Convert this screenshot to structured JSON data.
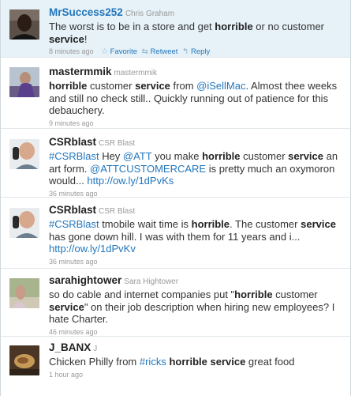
{
  "tweets": [
    {
      "handle": "MrSuccess252",
      "name": "Chris Graham",
      "text": [
        {
          "t": "The worst is to be in a store and get "
        },
        {
          "t": "horrible",
          "b": true
        },
        {
          "t": " or no customer "
        },
        {
          "t": "service",
          "b": true
        },
        {
          "t": "!"
        }
      ],
      "time": "8 minutes ago",
      "actions": [
        {
          "icon": "star-icon",
          "glyph": "☆",
          "label": "Favorite"
        },
        {
          "icon": "retweet-icon",
          "glyph": "⇆",
          "label": "Retweet"
        },
        {
          "icon": "reply-icon",
          "glyph": "↰",
          "label": "Reply"
        }
      ],
      "highlighted": true
    },
    {
      "handle": "mastermmik",
      "name": "mastermmik",
      "text": [
        {
          "t": "horrible",
          "b": true
        },
        {
          "t": " customer "
        },
        {
          "t": "service",
          "b": true
        },
        {
          "t": " from "
        },
        {
          "t": "@iSellMac",
          "l": true
        },
        {
          "t": ". Almost thee weeks and still no check still.. Quickly running out of patience for this debauchery."
        }
      ],
      "time": "9 minutes ago"
    },
    {
      "handle": "CSRblast",
      "name": "CSR Blast",
      "text": [
        {
          "t": "#CSRBlast",
          "l": true
        },
        {
          "t": " Hey "
        },
        {
          "t": "@ATT",
          "l": true
        },
        {
          "t": " you make "
        },
        {
          "t": "horrible",
          "b": true
        },
        {
          "t": " customer "
        },
        {
          "t": "service",
          "b": true
        },
        {
          "t": " an art form. "
        },
        {
          "t": "@ATTCUSTOMERCARE",
          "l": true
        },
        {
          "t": " is pretty much an oxymoron would... "
        },
        {
          "t": "http://ow.ly/1dPvKs",
          "l": true
        }
      ],
      "time": "36 minutes ago"
    },
    {
      "handle": "CSRblast",
      "name": "CSR Blast",
      "text": [
        {
          "t": "#CSRBlast",
          "l": true
        },
        {
          "t": " tmobile wait time is "
        },
        {
          "t": "horrible",
          "b": true
        },
        {
          "t": ". The customer "
        },
        {
          "t": "service",
          "b": true
        },
        {
          "t": " has gone down hill. I was with them for 11 years and i... "
        },
        {
          "t": "http://ow.ly/1dPvKv",
          "l": true
        }
      ],
      "time": "36 minutes ago"
    },
    {
      "handle": "sarahightower",
      "name": "Sara Hightower",
      "text": [
        {
          "t": "so do cable and internet companies put \""
        },
        {
          "t": "horrible",
          "b": true
        },
        {
          "t": " customer "
        },
        {
          "t": "service",
          "b": true
        },
        {
          "t": "\" on their job description when hiring new employees? I hate Charter."
        }
      ],
      "time": "46 minutes ago"
    },
    {
      "handle": "J_BANX",
      "name": "J",
      "text": [
        {
          "t": "Chicken Philly from "
        },
        {
          "t": "#ricks",
          "l": true
        },
        {
          "t": " "
        },
        {
          "t": "horrible",
          "b": true
        },
        {
          "t": " "
        },
        {
          "t": "service",
          "b": true
        },
        {
          "t": " great food"
        }
      ],
      "time": "1 hour ago"
    }
  ]
}
